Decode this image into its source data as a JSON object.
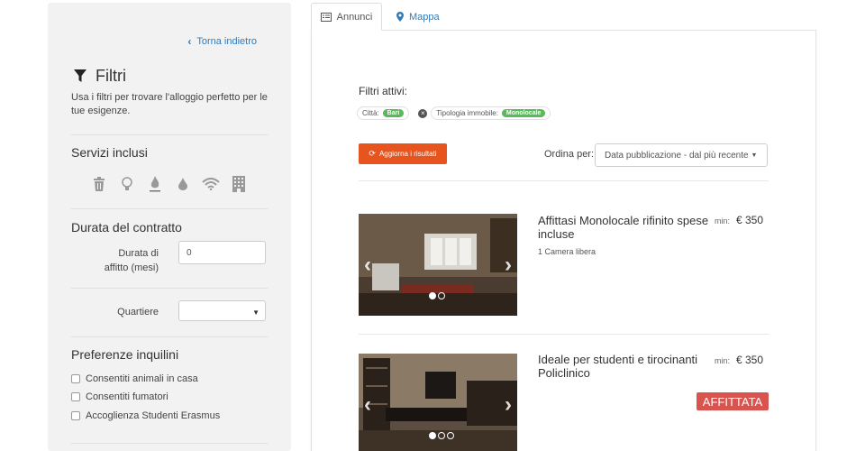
{
  "sidebar": {
    "back_label": "Torna indietro",
    "title": "Filtri",
    "description": "Usa i filtri per trovare l'alloggio perfetto per le tue esigenze.",
    "services_title": "Servizi inclusi",
    "services": [
      "trash-icon",
      "lightbulb-icon",
      "gas-flame-icon",
      "water-drop-icon",
      "wifi-icon",
      "building-icon"
    ],
    "contract_title": "Durata del contratto",
    "duration_label": "Durata di affitto (mesi)",
    "duration_value": "0",
    "neighborhood_label": "Quartiere",
    "neighborhood_value": "",
    "tenants_title": "Preferenze inquilini",
    "tenant_options": [
      "Consentiti animali in casa",
      "Consentiti fumatori",
      "Accoglienza Studenti Erasmus"
    ]
  },
  "tabs": [
    {
      "label": "Annunci",
      "icon": "list-icon",
      "active": true
    },
    {
      "label": "Mappa",
      "icon": "map-pin-icon",
      "active": false
    }
  ],
  "main": {
    "active_filters_title": "Filtri attivi:",
    "filters": [
      {
        "label": "Città:",
        "value": "Bari"
      },
      {
        "label": "Tipologia immobile:",
        "value": "Monolocale"
      }
    ],
    "update_button": "Aggiorna i risultati",
    "sort_label": "Ordina per:",
    "sort_value": "Data pubblicazione - dal più recente",
    "listings": [
      {
        "title": "Affittasi Monolocale rifinito spese incluse",
        "min_label": "min:",
        "price": "€ 350",
        "subtitle": "1 Camera libera",
        "status": ""
      },
      {
        "title": "Ideale per studenti e tirocinanti Policlinico",
        "min_label": "min:",
        "price": "€ 350",
        "subtitle": "",
        "status": "AFFITTATA"
      }
    ]
  },
  "colors": {
    "accent_orange": "#e8541e",
    "green_badge": "#5cb85c",
    "rented_red": "#d9534f",
    "link_blue": "#337ab7"
  }
}
